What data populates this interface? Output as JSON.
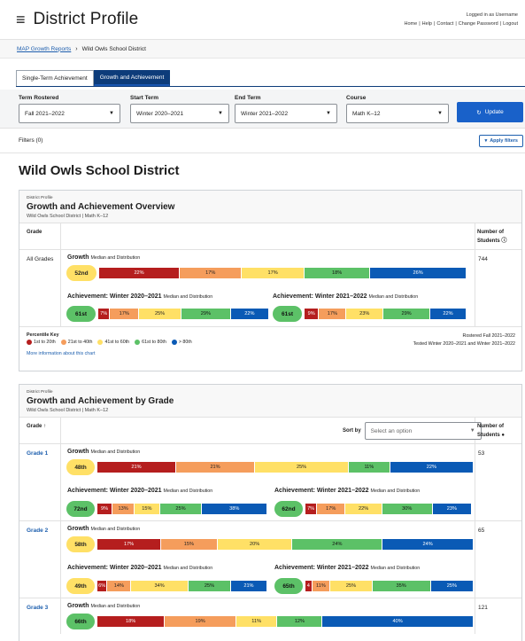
{
  "header": {
    "title": "District Profile",
    "logged_in": "Logged in as Username",
    "links": [
      "Home",
      "Help",
      "Contact",
      "Change Password",
      "Logout"
    ]
  },
  "breadcrumb": {
    "root": "MAP Growth Reports",
    "current": "Wild Owls School District"
  },
  "tabs": [
    {
      "label": "Single-Term Achievement",
      "active": false
    },
    {
      "label": "Growth and Achievement",
      "active": true
    }
  ],
  "controls": {
    "term_rostered": {
      "label": "Term Rostered",
      "value": "Fall 2021–2022"
    },
    "start_term": {
      "label": "Start Term",
      "value": "Winter 2020–2021"
    },
    "end_term": {
      "label": "End Term",
      "value": "Winter 2021–2022"
    },
    "course": {
      "label": "Course",
      "value": "Math K–12"
    },
    "update_label": "Update"
  },
  "filters": {
    "label": "Filters (0)",
    "apply_label": "Apply filters"
  },
  "district_name": "Wild Owls School District",
  "overview": {
    "kicker": "District Profile",
    "title": "Growth and Achievement Overview",
    "subtitle": "Wild Owls School District  |  Math K–12",
    "col_grade": "Grade",
    "col_num": "Number of Students",
    "row": {
      "grade": "All Grades",
      "count": "744",
      "growth": {
        "title": "Growth",
        "sub": "Median and Distribution",
        "median": "52nd",
        "dist": [
          "22%",
          "17%",
          "17%",
          "18%",
          "26%"
        ],
        "frac": [
          0.22,
          0.17,
          0.17,
          0.18,
          0.26
        ]
      },
      "ach_start": {
        "title": "Achievement: Winter 2020–2021",
        "sub": "Median and Distribution",
        "median": "61st",
        "dist": [
          "7%",
          "17%",
          "25%",
          "29%",
          "22%"
        ],
        "frac": [
          0.07,
          0.17,
          0.25,
          0.29,
          0.22
        ]
      },
      "ach_end": {
        "title": "Achievement: Winter 2021–2022",
        "sub": "Median and Distribution",
        "median": "61st",
        "dist": [
          "9%",
          "17%",
          "23%",
          "29%",
          "22%"
        ],
        "frac": [
          0.09,
          0.17,
          0.23,
          0.29,
          0.22
        ]
      }
    },
    "key": {
      "title": "Percentile Key",
      "items": [
        "1st to 20th",
        "21st to 40th",
        "41st to 60th",
        "61st to 80th",
        "> 80th"
      ],
      "more": "More information about this chart",
      "rostered": "Rostered Fall 2021–2022",
      "tested": "Tested Winter 2020–2021 and Winter 2021–2022"
    }
  },
  "by_grade": {
    "kicker": "District Profile",
    "title": "Growth and Achievement by Grade",
    "subtitle": "Wild Owls School District  |  Math K–12",
    "col_grade": "Grade ↑",
    "sort_label": "Sort by",
    "sort_placeholder": "Select an option",
    "col_num": "Number of Students",
    "rows": [
      {
        "grade": "Grade 1",
        "count": "53",
        "growth": {
          "title": "Growth",
          "sub": "Median and Distribution",
          "median": "48th",
          "dist": [
            "21%",
            "21%",
            "25%",
            "11%",
            "22%"
          ],
          "frac": [
            0.21,
            0.21,
            0.25,
            0.11,
            0.22
          ]
        },
        "ach_start": {
          "title": "Achievement: Winter 2020–2021",
          "sub": "Median and Distribution",
          "median": "72nd",
          "dist": [
            "9%",
            "13%",
            "15%",
            "25%",
            "38%"
          ],
          "frac": [
            0.09,
            0.13,
            0.15,
            0.25,
            0.38
          ]
        },
        "ach_end": {
          "title": "Achievement: Winter 2021–2022",
          "sub": "Median and Distribution",
          "median": "62nd",
          "dist": [
            "7%",
            "17%",
            "22%",
            "30%",
            "23%"
          ],
          "frac": [
            0.07,
            0.17,
            0.22,
            0.3,
            0.23
          ]
        }
      },
      {
        "grade": "Grade 2",
        "count": "65",
        "growth": {
          "title": "Growth",
          "sub": "Median and Distribution",
          "median": "58th",
          "dist": [
            "17%",
            "15%",
            "20%",
            "24%",
            "24%"
          ],
          "frac": [
            0.17,
            0.15,
            0.2,
            0.24,
            0.24
          ]
        },
        "ach_start": {
          "title": "Achievement: Winter 2020–2021",
          "sub": "Median and Distribution",
          "median": "49th",
          "dist": [
            "6%",
            "14%",
            "34%",
            "25%",
            "21%"
          ],
          "frac": [
            0.06,
            0.14,
            0.34,
            0.25,
            0.21
          ]
        },
        "ach_end": {
          "title": "Achievement: Winter 2021–2022",
          "sub": "Median and Distribution",
          "median": "65th",
          "dist": [
            "4",
            "11%",
            "25%",
            "35%",
            "25%"
          ],
          "frac": [
            0.04,
            0.11,
            0.25,
            0.35,
            0.25
          ]
        }
      },
      {
        "grade": "Grade 3",
        "count": "121",
        "growth": {
          "title": "Growth",
          "sub": "Median and Distribution",
          "median": "66th",
          "dist": [
            "18%",
            "19%",
            "11%",
            "12%",
            "40%"
          ],
          "frac": [
            0.18,
            0.19,
            0.11,
            0.12,
            0.4
          ]
        }
      }
    ]
  },
  "colors": {
    "c1": "#b51e1e",
    "c2": "#f59d5c",
    "c3": "#ffe066",
    "c4": "#5cc167",
    "c5": "#0a5ab5",
    "brand": "#0d3c7a",
    "button": "#1961c9"
  }
}
